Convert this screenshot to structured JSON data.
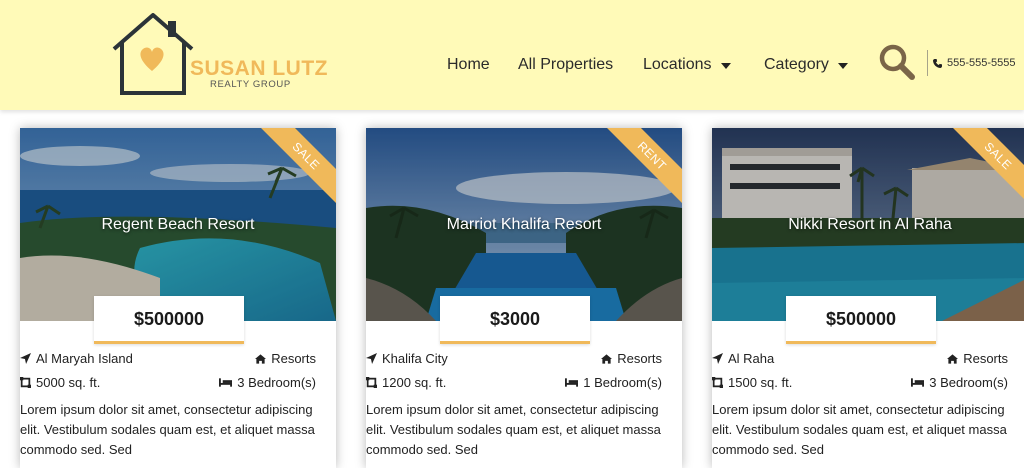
{
  "brand": {
    "name": "SUSAN LUTZ",
    "subtitle": "REALTY GROUP"
  },
  "nav": [
    {
      "label": "Home"
    },
    {
      "label": "All Properties"
    },
    {
      "label": "Locations"
    },
    {
      "label": "Category"
    }
  ],
  "phone": "555-555-5555",
  "colors": {
    "header_bg": "#fffab8",
    "accent": "#f0b95a",
    "logo_outline": "#2b3338"
  },
  "cards": [
    {
      "title": "Regent Beach Resort",
      "badge": "SALE",
      "price": "$500000",
      "location": "Al Maryah Island",
      "category": "Resorts",
      "area": "5000 sq. ft.",
      "bedrooms": "3 Bedroom(s)",
      "desc": "Lorem ipsum dolor sit amet, consectetur adipiscing elit. Vestibulum sodales quam est, et aliquet massa commodo sed. Sed"
    },
    {
      "title": "Marriot Khalifa Resort",
      "badge": "RENT",
      "price": "$3000",
      "location": "Khalifa City",
      "category": "Resorts",
      "area": "1200 sq. ft.",
      "bedrooms": "1 Bedroom(s)",
      "desc": "Lorem ipsum dolor sit amet, consectetur adipiscing elit. Vestibulum sodales quam est, et aliquet massa commodo sed. Sed"
    },
    {
      "title": "Nikki Resort in Al Raha",
      "badge": "SALE",
      "price": "$500000",
      "location": "Al Raha",
      "category": "Resorts",
      "area": "1500 sq. ft.",
      "bedrooms": "3 Bedroom(s)",
      "desc": "Lorem ipsum dolor sit amet, consectetur adipiscing elit. Vestibulum sodales quam est, et aliquet massa commodo sed. Sed"
    }
  ]
}
